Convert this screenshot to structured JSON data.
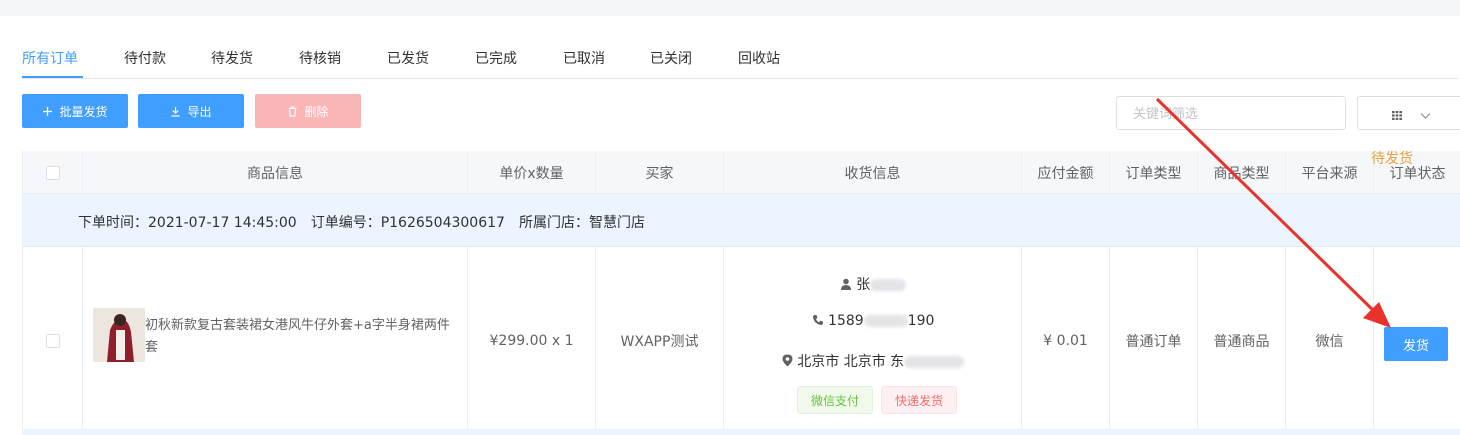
{
  "tabs": [
    {
      "label": "所有订单",
      "active": true
    },
    {
      "label": "待付款"
    },
    {
      "label": "待发货"
    },
    {
      "label": "待核销"
    },
    {
      "label": "已发货"
    },
    {
      "label": "已完成"
    },
    {
      "label": "已取消"
    },
    {
      "label": "已关闭"
    },
    {
      "label": "回收站"
    }
  ],
  "toolbar": {
    "batch_ship_label": "批量发货",
    "export_label": "导出",
    "delete_label": "删除",
    "search_placeholder": "关键词筛选"
  },
  "table": {
    "headers": [
      "商品信息",
      "单价x数量",
      "买家",
      "收货信息",
      "应付金额",
      "订单类型",
      "商品类型",
      "平台来源",
      "订单状态"
    ]
  },
  "order": {
    "time": "下单时间：2021-07-17 14:45:00",
    "number": "订单编号：P1626504300617",
    "store": "所属门店：智慧门店",
    "product_name": "初秋新款复古套装裙女港风牛仔外套+a字半身裙两件套",
    "price_qty": "¥299.00 x 1",
    "buyer": "WXAPP测试",
    "receiver_name": "张",
    "receiver_phone_start": "1589",
    "receiver_phone_end": "190",
    "receiver_addr": "北京市 北京市 东",
    "pay_tag": "微信支付",
    "delivery_tag": "快递发货",
    "amount": "¥ 0.01",
    "order_type": "普通订单",
    "goods_type": "普通商品",
    "platform": "微信",
    "status": "待发货",
    "ship_button": "发货"
  },
  "colors": {
    "accent": "#409eff",
    "warning": "#e6a23c",
    "annotation_arrow": "#e8322a"
  },
  "icons": [
    "plus-icon",
    "download-icon",
    "trash-icon",
    "grid-icon",
    "chevron-down-icon",
    "user-icon",
    "phone-icon",
    "location-icon"
  ]
}
